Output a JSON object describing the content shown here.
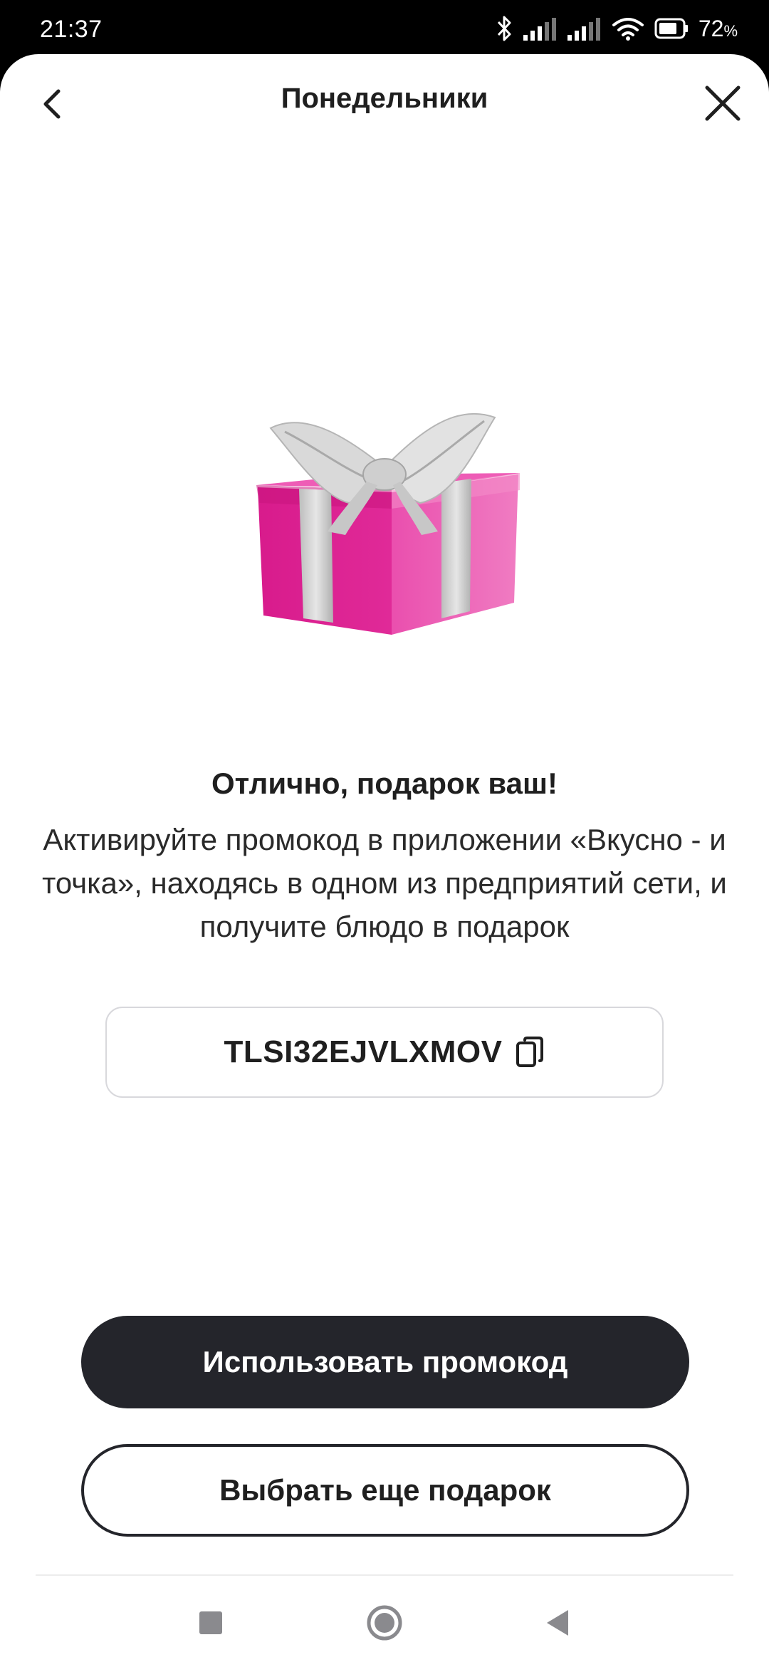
{
  "status_bar": {
    "time": "21:37",
    "battery_percent": "72",
    "battery_unit": "%",
    "icons": [
      "bluetooth-icon",
      "signal-icon",
      "signal-icon",
      "wifi-icon",
      "battery-icon"
    ]
  },
  "header": {
    "title": "Понедельники",
    "back_icon": "chevron-left-icon",
    "close_icon": "close-icon"
  },
  "content": {
    "image": "gift-box",
    "headline": "Отлично, подарок ваш!",
    "description": "Активируйте промокод в приложении «Вкусно - и точка», находясь в одном из предприятий сети, и получите блюдо в подарок",
    "promo_code": "TLSI32EJVLXMOV",
    "copy_icon": "copy-icon"
  },
  "actions": {
    "primary_label": "Использовать промокод",
    "secondary_label": "Выбрать еще подарок"
  },
  "navigation": {
    "icons": [
      "square-icon",
      "circle-icon",
      "triangle-back-icon"
    ]
  },
  "colors": {
    "primary_button": "#24252b",
    "gift_box": "#e0289a",
    "ribbon": "#c8c8c8"
  }
}
